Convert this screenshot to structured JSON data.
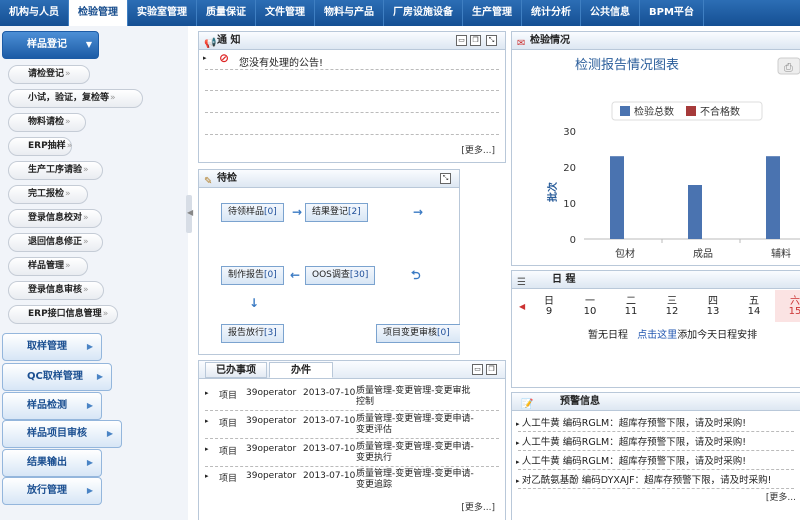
{
  "topnav": [
    {
      "label": "机构与人员",
      "active": false
    },
    {
      "label": "检验管理",
      "active": true
    },
    {
      "label": "实验室管理",
      "active": false
    },
    {
      "label": "质量保证",
      "active": false
    },
    {
      "label": "文件管理",
      "active": false
    },
    {
      "label": "物料与产品",
      "active": false
    },
    {
      "label": "厂房设施设备",
      "active": false
    },
    {
      "label": "生产管理",
      "active": false
    },
    {
      "label": "统计分析",
      "active": false
    },
    {
      "label": "公共信息",
      "active": false
    },
    {
      "label": "BPM平台",
      "active": false
    }
  ],
  "sidebar": {
    "active_section": "样品登记",
    "sub_items": [
      "请检登记",
      "小试，验证，复检等",
      "物料请检",
      "ERP抽样",
      "生产工序请验",
      "完工报检",
      "登录信息校对",
      "退回信息修正",
      "样品管理",
      "登录信息审核",
      "ERP接口信息管理"
    ],
    "sections": [
      "取样管理",
      "QC取样管理",
      "样品检测",
      "样品项目审核",
      "结果输出",
      "放行管理"
    ]
  },
  "notice": {
    "title": "通 知",
    "message": "您没有处理的公告!",
    "more": "[更多...]"
  },
  "pending": {
    "title": "待检",
    "nodes": [
      {
        "label": "待领样品",
        "count": "[0]"
      },
      {
        "label": "结果登记",
        "count": "[2]"
      },
      {
        "label": "制作报告",
        "count": "[0]"
      },
      {
        "label": "OOS调查",
        "count": "[30]"
      },
      {
        "label": "报告放行",
        "count": "[3]"
      },
      {
        "label": "项目变更审核",
        "count": "[0]"
      }
    ]
  },
  "tasks": {
    "tabs": [
      "已办事项",
      "办件"
    ],
    "rows": [
      {
        "c1": "项目",
        "c2": "39operator",
        "c3": "2013-07-10",
        "c4a": "质量管理-变更管理-变更审批",
        "c4b": "控制"
      },
      {
        "c1": "项目",
        "c2": "39operator",
        "c3": "2013-07-10",
        "c4a": "质量管理-变更管理-变更申请-",
        "c4b": "变更评估"
      },
      {
        "c1": "项目",
        "c2": "39operator",
        "c3": "2013-07-10",
        "c4a": "质量管理-变更管理-变更申请-",
        "c4b": "变更执行"
      },
      {
        "c1": "项目",
        "c2": "39operator",
        "c3": "2013-07-10",
        "c4a": "质量管理-变更管理-变更申请-",
        "c4b": "变更追踪"
      }
    ],
    "more": "[更多...]"
  },
  "inspection": {
    "title": "检验情况"
  },
  "chart_data": {
    "type": "bar",
    "title": "检测报告情况图表",
    "ylabel": "批次",
    "categories": [
      "包材",
      "成品",
      "辅料"
    ],
    "series": [
      {
        "name": "检验总数",
        "color": "#4a73b0",
        "values": [
          23,
          15,
          23
        ]
      },
      {
        "name": "不合格数",
        "color": "#a63a3a",
        "values": [
          0,
          0,
          0
        ]
      }
    ],
    "ylim": [
      0,
      30
    ],
    "yticks": [
      0,
      10,
      20,
      30
    ],
    "grid": false,
    "legend": "top"
  },
  "schedule": {
    "title": "日 程",
    "days": [
      {
        "day": "日",
        "date": "9"
      },
      {
        "day": "一",
        "date": "10"
      },
      {
        "day": "二",
        "date": "11"
      },
      {
        "day": "三",
        "date": "12"
      },
      {
        "day": "四",
        "date": "13"
      },
      {
        "day": "五",
        "date": "14"
      },
      {
        "day": "六",
        "date": "15",
        "highlight": true
      }
    ],
    "empty_text": "暂无日程",
    "link_text": "点击这里",
    "suffix_text": "添加今天日程安排"
  },
  "alerts": {
    "title": "预警信息",
    "rows": [
      "人工牛黄  编码RGLM：超库存预警下限，请及时采购!",
      "人工牛黄  编码RGLM：超库存预警下限，请及时采购!",
      "人工牛黄  编码RGLM：超库存预警下限，请及时采购!",
      "对乙酰氨基酚  编码DYXAJF：超库存预警下限，请及时采购!"
    ],
    "more": "[更多..."
  },
  "colors": {
    "nav": "#1a5aa3",
    "accent": "#1c5ba5",
    "bar": "#4a73b0",
    "bar2": "#a63a3a",
    "highlight_day": "#fbe3e3"
  }
}
